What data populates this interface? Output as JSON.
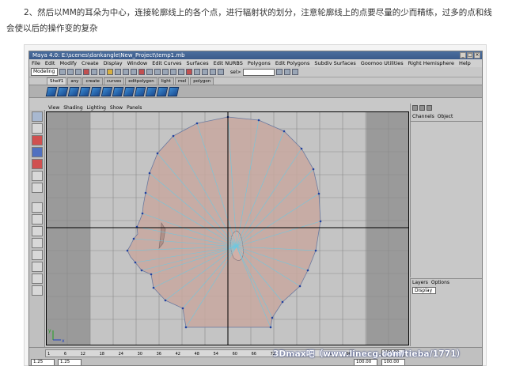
{
  "article": {
    "line1": "2、然后以MM的耳朵为中心，连接轮廓线上的各个点，进行辐射状的划分，注意轮廓线上的点要尽量的少而精练，过多的点和线",
    "line2": "会使以后的操作变的复杂"
  },
  "maya": {
    "title": "Maya 4.0: E:\\scenes\\dankangle\\New_Project\\temp1.mb",
    "window_buttons": [
      "_",
      "□",
      "×"
    ],
    "menu": [
      "File",
      "Edit",
      "Modify",
      "Create",
      "Display",
      "Window",
      "Edit Curves",
      "Surfaces",
      "Edit NURBS",
      "Polygons",
      "Edit Polygons",
      "Subdiv Surfaces",
      "Goomoo Utilities",
      "Right Hemisphere",
      "Help"
    ],
    "mode": "Modeling",
    "selection_label": "sel>",
    "shelf_tabs": [
      "Shelf1",
      "any",
      "create",
      "curves",
      "editpolygon",
      "light",
      "mel",
      "polygon"
    ],
    "panel_menu": [
      "View",
      "Shading",
      "Lighting",
      "Show",
      "Panels"
    ],
    "channel_box": {
      "tabs": [
        "Channels",
        "Object"
      ]
    },
    "layers": {
      "menu": [
        "Layers",
        "Options"
      ],
      "display": "Display"
    },
    "timeline": {
      "ticks": [
        "1",
        "6",
        "12",
        "18",
        "24",
        "30",
        "36",
        "42",
        "48",
        "54",
        "60",
        "66",
        "72",
        "78",
        "84",
        "90",
        "96"
      ],
      "end_field": "100.00"
    },
    "range": {
      "start": "1.25",
      "current": "1.25",
      "end": "100.00",
      "end2": "100.00"
    },
    "axis_label": {
      "x": "x",
      "y": "y"
    }
  },
  "watermark": "3Dmax吧（www.linecg.com/tieba/1771）"
}
